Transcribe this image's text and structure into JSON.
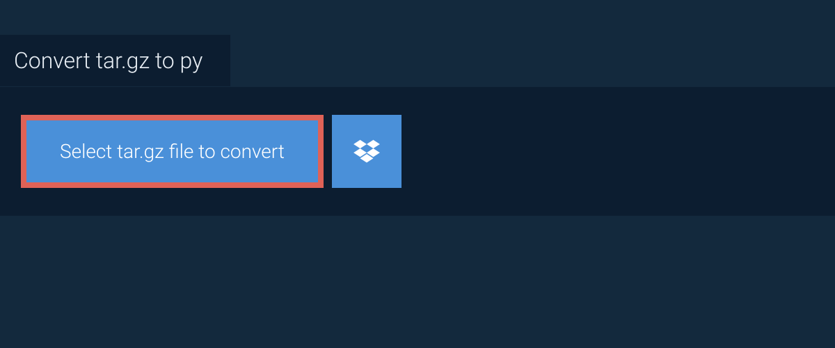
{
  "tab": {
    "title": "Convert tar.gz to py"
  },
  "panel": {
    "select_button_label": "Select tar.gz file to convert"
  },
  "colors": {
    "page_bg": "#13293d",
    "panel_bg": "#0c1d30",
    "button_bg": "#4a90d9",
    "button_border": "#e06257",
    "text_light": "#ffffff"
  }
}
